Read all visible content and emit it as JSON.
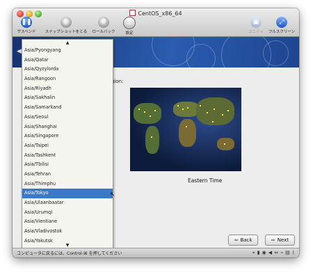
{
  "window": {
    "title": "CentOS_x86_64"
  },
  "toolbar": {
    "suspend": "サスペンド",
    "snapshot": "スナップショットをとる",
    "rollback": "ロールバック",
    "settings": "設定",
    "unity": "ユニティ",
    "fullscreen": "フルスクリーン"
  },
  "installer": {
    "region_label": "gion:",
    "timezone_name": "Eastern Time",
    "back_label": "Back",
    "next_label": "Next"
  },
  "timezone_list": {
    "selected_index": 16,
    "items": [
      "Asia/Pyongyang",
      "Asia/Qatar",
      "Asia/Qyzylorda",
      "Asia/Rangoon",
      "Asia/Riyadh",
      "Asia/Sakhalin",
      "Asia/Samarkand",
      "Asia/Seoul",
      "Asia/Shanghai",
      "Asia/Singapore",
      "Asia/Taipei",
      "Asia/Tashkent",
      "Asia/Tbilisi",
      "Asia/Tehran",
      "Asia/Thimphu",
      "Asia/Tokyo",
      "Asia/Ulaanbaatar",
      "Asia/Urumqi",
      "Asia/Vientiane",
      "Asia/Vladivostok",
      "Asia/Yakutsk"
    ]
  },
  "statusbar": {
    "hint": "コンピュータに戻るには、Control-⌘ を押してください"
  },
  "colors": {
    "accent": "#3d77c8",
    "banner": "#2b5cb0"
  },
  "icons": [
    "pause-icon",
    "camera-icon",
    "rewind-icon",
    "settings-icon",
    "unity-icon",
    "fullscreen-icon",
    "back-arrow-icon",
    "next-arrow-icon"
  ]
}
